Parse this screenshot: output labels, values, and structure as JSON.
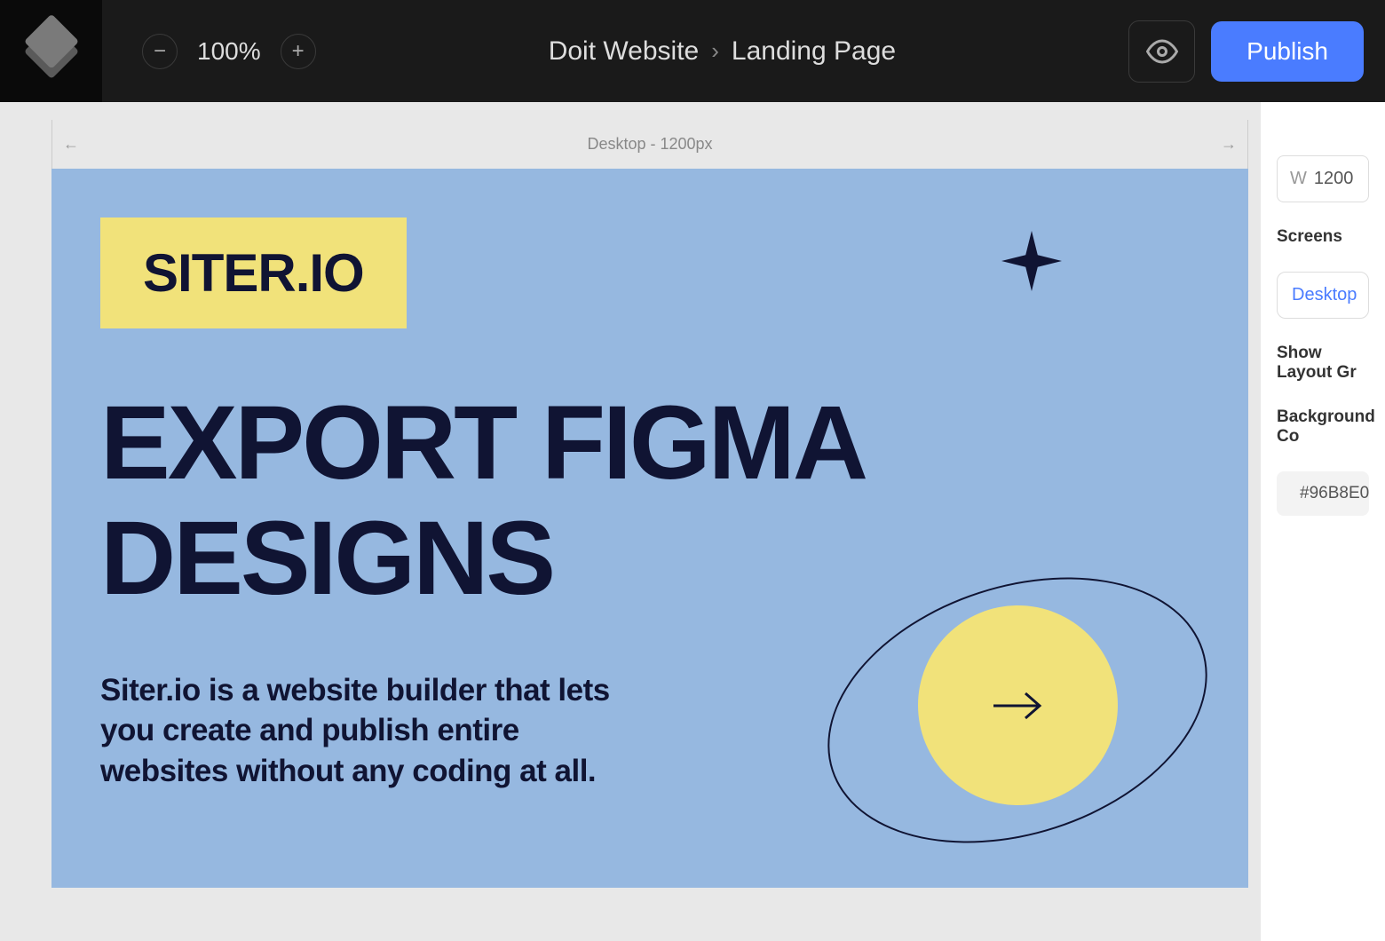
{
  "header": {
    "zoom": "100%",
    "breadcrumb_project": "Doit Website",
    "breadcrumb_page": "Landing Page",
    "publish_label": "Publish"
  },
  "canvas": {
    "breakpoint_label": "Desktop - 1200px",
    "brand": "SITER.IO",
    "headline": "EXPORT FIGMA DESIGNS",
    "subheadline": "Siter.io is a website builder that lets you create and publish entire websites without any coding at all."
  },
  "sidebar": {
    "width_prefix": "W",
    "width_value": "1200",
    "screens_label": "Screens",
    "screen_selected": "Desktop",
    "layout_grid_label": "Show Layout Gr",
    "bg_color_label": "Background Co",
    "bg_color_hex": "#96B8E0"
  }
}
